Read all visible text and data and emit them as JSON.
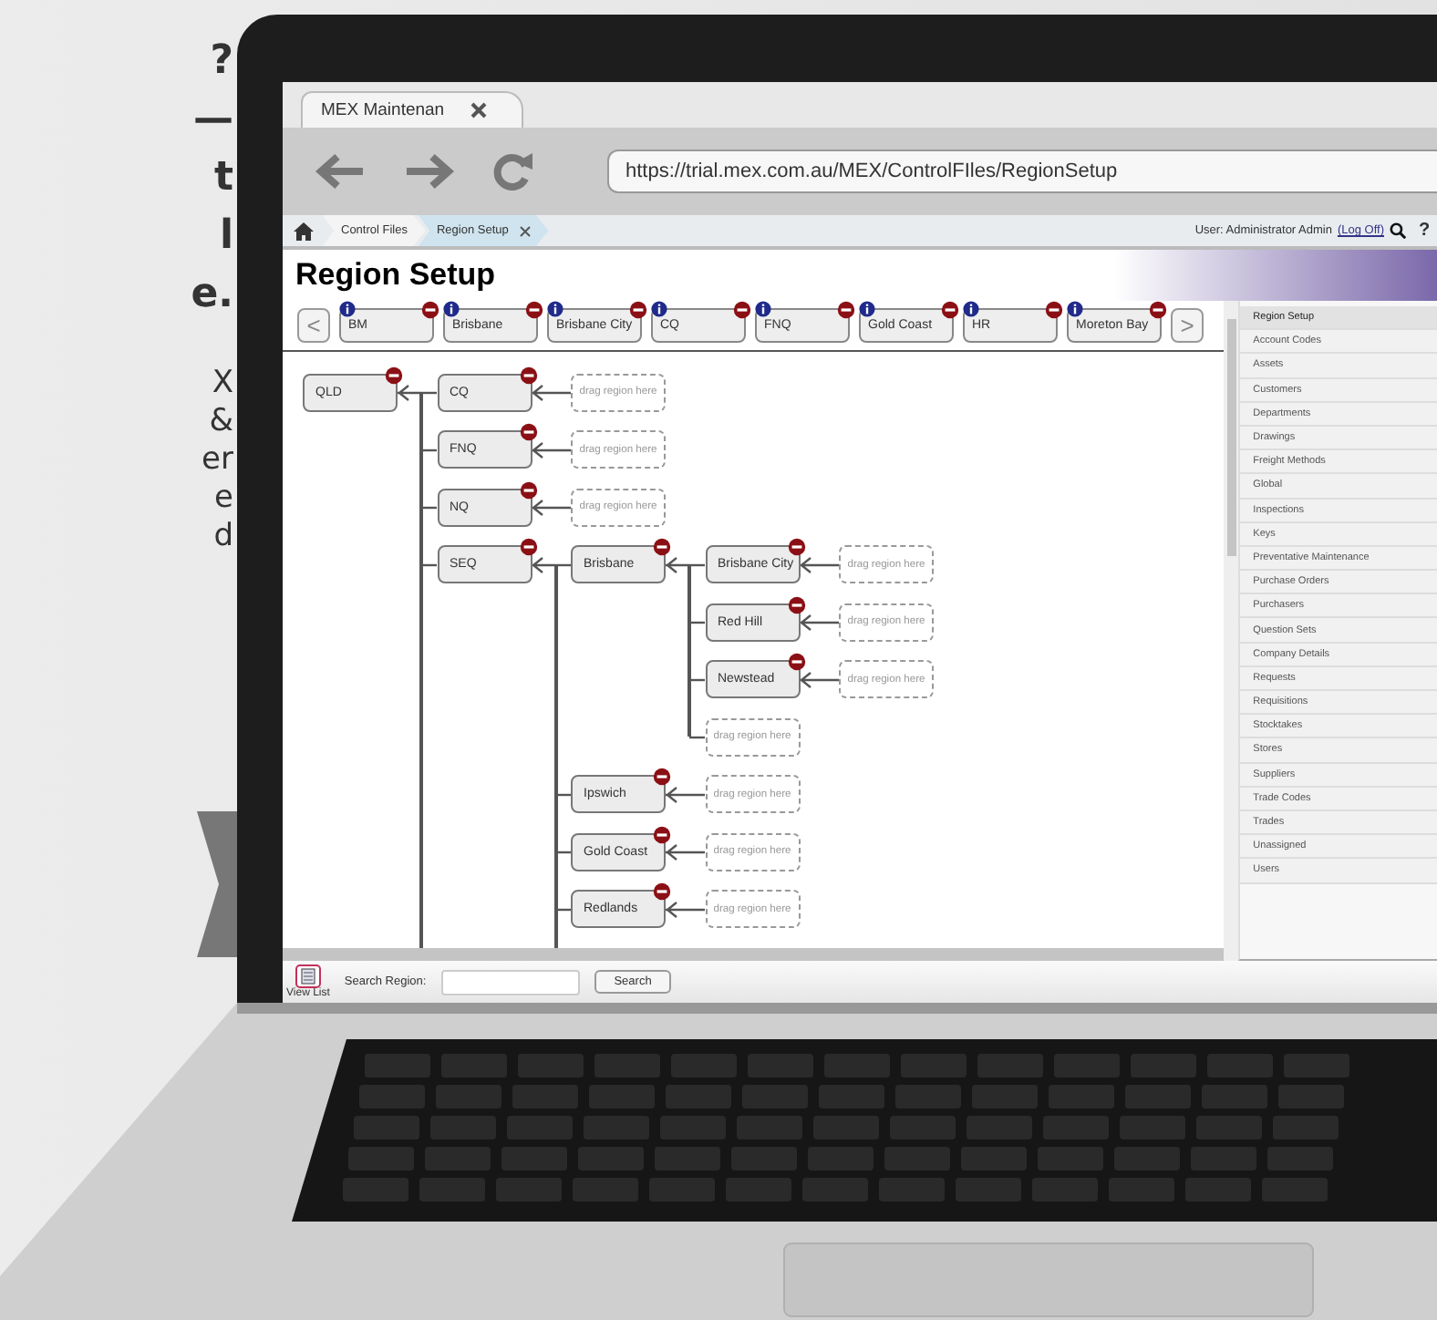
{
  "side_text": {
    "heading_lines": [
      "?",
      "—",
      "t",
      "l",
      "e."
    ],
    "body_lines": [
      "X",
      "&",
      "er",
      "e",
      "d"
    ]
  },
  "browser": {
    "tab_title": "MEX Maintenan",
    "url": "https://trial.mex.com.au/MEX/ControlFIles/RegionSetup"
  },
  "breadcrumbs": [
    {
      "label": "Control Files",
      "selected": false
    },
    {
      "label": "Region Setup",
      "selected": true
    }
  ],
  "user": {
    "text": "User: Administrator Admin",
    "link": "(Log Off)"
  },
  "help_glyph": "?",
  "page_title": "Region Setup",
  "region_strip": {
    "prev": "<",
    "next": ">",
    "regions": [
      "BM",
      "Brisbane",
      "Brisbane City",
      "CQ",
      "FNQ",
      "Gold Coast",
      "HR",
      "Moreton Bay"
    ]
  },
  "tree": {
    "name": "QLD",
    "more_below": true,
    "children": [
      {
        "name": "CQ",
        "drop_hint": "drag region here"
      },
      {
        "name": "FNQ",
        "drop_hint": "drag region here"
      },
      {
        "name": "NQ",
        "drop_hint": "drag region here"
      },
      {
        "name": "SEQ",
        "more_below": true,
        "children": [
          {
            "name": "Brisbane",
            "drop_hint": "drag region here",
            "children": [
              {
                "name": "Brisbane City",
                "drop_hint": "drag region here"
              },
              {
                "name": "Red Hill",
                "drop_hint": "drag region here"
              },
              {
                "name": "Newstead",
                "drop_hint": "drag region here"
              }
            ]
          },
          {
            "name": "Ipswich",
            "drop_hint": "drag region here"
          },
          {
            "name": "Gold Coast",
            "drop_hint": "drag region here"
          },
          {
            "name": "Redlands",
            "drop_hint": "drag region here"
          }
        ]
      }
    ]
  },
  "sidebar": {
    "items": [
      {
        "label": "Region Setup",
        "selected": true
      },
      {
        "label": "Account Codes",
        "selected": false
      },
      {
        "label": "Assets",
        "selected": false
      },
      {
        "label": "Customers",
        "selected": false
      },
      {
        "label": "Departments",
        "selected": false
      },
      {
        "label": "Drawings",
        "selected": false
      },
      {
        "label": "Freight Methods",
        "selected": false
      },
      {
        "label": "Global",
        "selected": false
      },
      {
        "label": "Inspections",
        "selected": false
      },
      {
        "label": "Keys",
        "selected": false
      },
      {
        "label": "Preventative Maintenance",
        "selected": false
      },
      {
        "label": "Purchase Orders",
        "selected": false
      },
      {
        "label": "Purchasers",
        "selected": false
      },
      {
        "label": "Question Sets",
        "selected": false
      },
      {
        "label": "Company Details",
        "selected": false
      },
      {
        "label": "Requests",
        "selected": false
      },
      {
        "label": "Requisitions",
        "selected": false
      },
      {
        "label": "Stocktakes",
        "selected": false
      },
      {
        "label": "Stores",
        "selected": false
      },
      {
        "label": "Suppliers",
        "selected": false
      },
      {
        "label": "Trade Codes",
        "selected": false
      },
      {
        "label": "Trades",
        "selected": false
      },
      {
        "label": "Unassigned",
        "selected": false
      },
      {
        "label": "Users",
        "selected": false
      }
    ]
  },
  "footer": {
    "view_list": "View List",
    "search_label": "Search Region:",
    "search_button": "Search"
  }
}
